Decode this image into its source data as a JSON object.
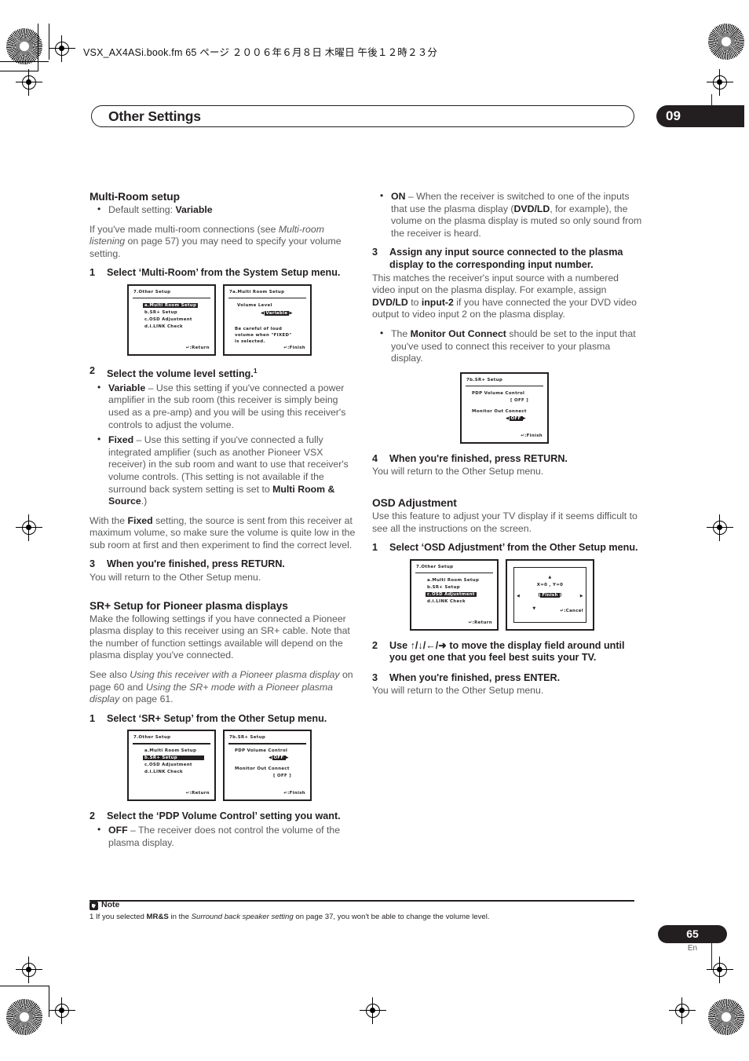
{
  "header": {
    "filename_line": "VSX_AX4ASi.book.fm 65 ページ  ２００６年６月８日  木曜日  午後１２時２３分",
    "chapter_title": "Other Settings",
    "chapter_number": "09"
  },
  "footer": {
    "note_label": "Note",
    "note_text_1": "1 If you selected ",
    "note_bold_1": "MR&S",
    "note_text_2": " in the ",
    "note_italic_1": "Surround back speaker setting",
    "note_text_3": " on page 37, you won't be able to change the volume level.",
    "page_number": "65",
    "page_language": "En"
  },
  "left_column": {
    "multiroom": {
      "heading": "Multi-Room setup",
      "default_bullet_prefix": "Default setting: ",
      "default_bullet_value": "Variable",
      "intro_1": "If you've made multi-room connections (see ",
      "intro_italic": "Multi-room listening",
      "intro_2": " on page 57) you may need to specify your volume setting.",
      "step1_num": "1",
      "step1_text": "Select ‘Multi-Room’ from the System Setup menu.",
      "step2_num": "2",
      "step2_text": "Select the volume level setting.",
      "step2_footnote": "1",
      "bullet_variable_label": "Variable",
      "bullet_variable_text": " – Use this setting if you've connected a power amplifier in the sub room (this receiver is simply being used as a pre-amp) and you will be using this receiver's controls to adjust the volume.",
      "bullet_fixed_label": "Fixed",
      "bullet_fixed_text_a": " – Use this setting if you've connected a fully integrated amplifier (such as another Pioneer VSX receiver) in the sub room and want to use that receiver's volume controls. (This setting is not available if the surround back system setting is set to ",
      "bullet_fixed_bold_b": "Multi Room & Source",
      "bullet_fixed_text_c": ".)",
      "fixed_para_a": "With the ",
      "fixed_para_bold": "Fixed",
      "fixed_para_b": " setting, the source is sent from this receiver at maximum volume, so make sure the volume is quite low in the sub room at first and then experiment to find the correct level.",
      "step3_num": "3",
      "step3_text": "When you're finished, press RETURN.",
      "step3_after": "You will return to the Other Setup menu."
    },
    "srplus": {
      "heading": "SR+ Setup for Pioneer plasma displays",
      "para_1": "Make the following settings if you have connected a Pioneer plasma display to this receiver using an SR+ cable. Note that the number of function settings available will depend on the plasma display you've connected.",
      "para_2_a": "See also ",
      "para_2_italic_a": "Using this receiver with a Pioneer plasma display",
      "para_2_b": " on page 60 and ",
      "para_2_italic_b": "Using the SR+ mode with a Pioneer plasma display",
      "para_2_c": " on page 61.",
      "step1_num": "1",
      "step1_text": "Select ‘SR+ Setup’ from the Other Setup menu.",
      "step2_num": "2",
      "step2_text": "Select the ‘PDP Volume Control’ setting you want.",
      "bullet_off_label": "OFF",
      "bullet_off_text": " – The receiver does not control the volume of the plasma display."
    },
    "osd_screens_1": [
      {
        "title": "7.Other Setup",
        "lines": [
          "a.Multi Room Setup",
          "b.SR+ Setup",
          "c.OSD Adjustment",
          "d.i.LINK Check"
        ],
        "highlight_index": 0,
        "footer": "↵:Return"
      },
      {
        "title": "7a.Multi Room Setup",
        "label": "Volume Level",
        "value": "Variable",
        "note_lines": [
          "Be careful of loud",
          "volume when \"FIXED\"",
          "is selected."
        ],
        "footer": "↵:Finish"
      }
    ],
    "osd_screens_2": [
      {
        "title": "7.Other Setup",
        "lines": [
          "a.Multi Room Setup",
          "b.SR+ Setup",
          "c.OSD Adjustment",
          "d.i.LINK Check"
        ],
        "highlight_index": 1,
        "footer": "↵:Return"
      },
      {
        "title": "7b.SR+ Setup",
        "label_1": "PDP Volume Control",
        "value_1": "OFF",
        "label_2": "Monitor Out Connect",
        "value_2": "OFF",
        "footer": "↵:Finish"
      }
    ]
  },
  "right_column": {
    "srplus_cont": {
      "bullet_on_label": "ON",
      "bullet_on_text": " – When the receiver is switched to one of the inputs that use the plasma display (",
      "bullet_on_bold_2": "DVD/LD",
      "bullet_on_text_2": ", for example), the volume on the plasma display is muted so only sound from the receiver is heard.",
      "step3_num": "3",
      "step3_text": "Assign any input source connected to the plasma display to the corresponding input number.",
      "step3_para_a": "This matches the receiver's input source with a numbered video input on the plasma display. For example, assign ",
      "step3_bold_a": "DVD/LD",
      "step3_para_b": " to ",
      "step3_bold_b": "input-2",
      "step3_para_c": " if you have connected the your DVD video output to video input 2 on the plasma display.",
      "bullet_monitor_a": "The ",
      "bullet_monitor_bold": "Monitor Out Connect",
      "bullet_monitor_b": " should be set to the input that you've used to connect this receiver to your plasma display.",
      "step4_num": "4",
      "step4_text": "When you're finished, press RETURN.",
      "step4_after": "You will return to the Other Setup menu."
    },
    "osd_screen_3": {
      "title": "7b.SR+ Setup",
      "label_1": "PDP Volume Control",
      "value_1": "OFF",
      "label_2": "Monitor Out Connect",
      "value_2": "OFF",
      "footer": "↵:Finish"
    },
    "osd": {
      "heading": "OSD Adjustment",
      "para_1": "Use this feature to adjust your TV display if it seems difficult to see all the instructions on the screen.",
      "step1_num": "1",
      "step1_text": "Select ‘OSD Adjustment’ from the Other Setup menu.",
      "step2_num": "2",
      "step2_text": "Use ↑/↓/←/➜ to move the display field around until you get one that you feel best suits your TV.",
      "step3_num": "3",
      "step3_text": "When you're finished, press ENTER.",
      "step3_after": "You will return to the Other Setup menu."
    },
    "osd_screens_4": [
      {
        "title": "7.Other Setup",
        "lines": [
          "a.Multi Room Setup",
          "b.SR+ Setup",
          "c.OSD Adjustment",
          "d.i.LINK Check"
        ],
        "highlight_index": 2,
        "footer": "↵:Return"
      },
      {
        "coords": "X=0 , Y=0",
        "button": "Finish",
        "footer": "↵:Cancel"
      }
    ]
  }
}
